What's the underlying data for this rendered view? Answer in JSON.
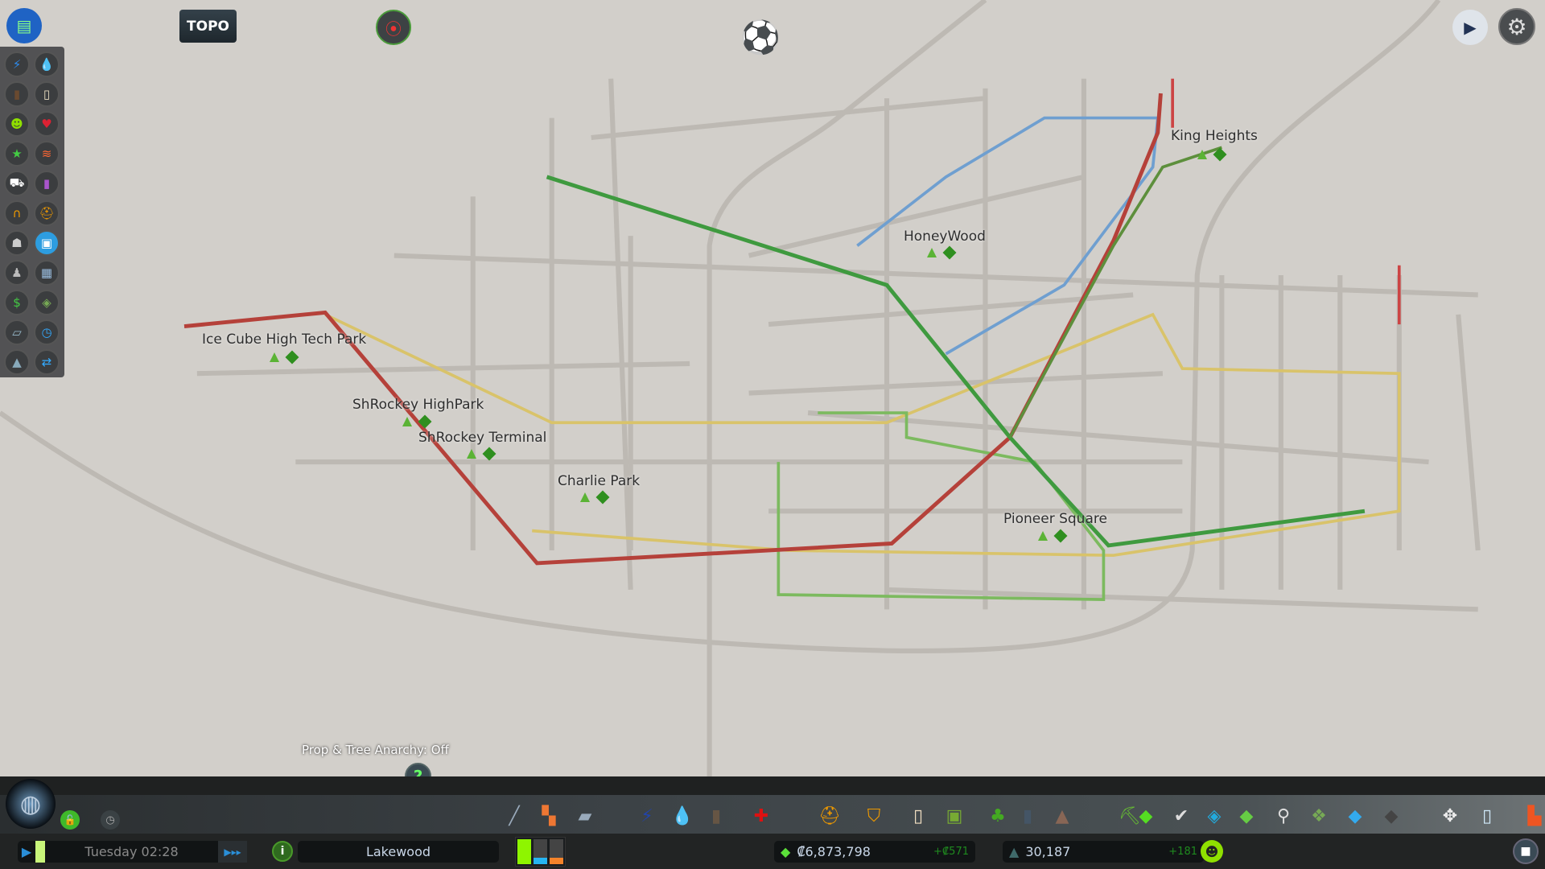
{
  "view_mode": "TOPO",
  "map_labels": [
    {
      "name": "Ice Cube High Tech Park"
    },
    {
      "name": "ShRockey HighPark"
    },
    {
      "name": "ShRockey Terminal"
    },
    {
      "name": "Charlie Park"
    },
    {
      "name": "HoneyWood"
    },
    {
      "name": "King Heights"
    },
    {
      "name": "Pioneer Square"
    }
  ],
  "anarchy_status": "Prop & Tree Anarchy: Off",
  "help_glyph": "?",
  "info_views": [
    "electricity",
    "water",
    "garbage",
    "education",
    "happiness",
    "health",
    "landvalue",
    "wind",
    "traffic",
    "pollution",
    "noise",
    "fire",
    "crime",
    "public-transport",
    "population",
    "buildings",
    "economy",
    "natural-resources",
    "terrain",
    "routes",
    "heights",
    "traffic-routes"
  ],
  "toolbar_icons": [
    "roads",
    "zoning",
    "districts",
    "electricity",
    "water",
    "garbage",
    "healthcare",
    "fire-department",
    "police",
    "education",
    "public-transport",
    "beautification",
    "monuments",
    "unique-buildings",
    "landscaping",
    "money",
    "policies",
    "areas",
    "lock",
    "search",
    "resources",
    "water-tool",
    "terrain-tool",
    "move-it",
    "selection",
    "bulldozer"
  ],
  "status": {
    "day_time": "Tuesday 02:28",
    "city_name": "Lakewood",
    "money": "₡6,873,798",
    "money_delta": "+₡571",
    "population": "30,187",
    "population_delta": "+181",
    "demand": {
      "residential": 1.0,
      "commercial": 0.25,
      "industrial": 0.25
    }
  },
  "colors": {
    "red_line": "#b5413a",
    "green_line": "#3f9a3f",
    "blue_line": "#6f9fd0",
    "yellow_line": "#d9c36a",
    "positive": "#2ea02e"
  }
}
